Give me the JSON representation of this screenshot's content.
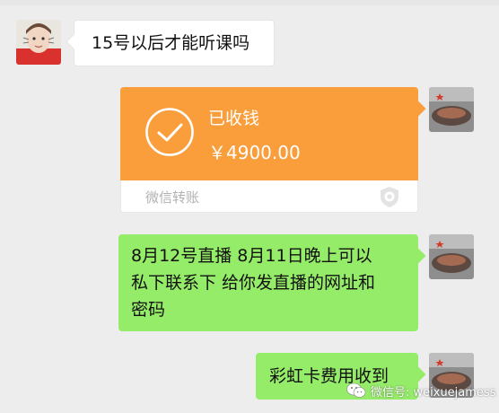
{
  "messages": [
    {
      "side": "left",
      "type": "text",
      "text": "15号以后才能听课吗"
    },
    {
      "side": "right",
      "type": "transfer",
      "status": "已收钱",
      "amount": "￥4900.00",
      "label": "微信转账",
      "icons": {
        "status": "check-circle-icon",
        "footer": "shield-icon"
      }
    },
    {
      "side": "right",
      "type": "text",
      "lines": [
        "8月12号直播 8月11日晚上可以",
        "私下联系下 给你发直播的网址和",
        "密码"
      ]
    },
    {
      "side": "right",
      "type": "text",
      "text": "彩虹卡费用收到"
    }
  ],
  "watermark": {
    "text": "微信号: weixuejamess",
    "icon": "wechat-logo-icon"
  },
  "colors": {
    "background": "#ededed",
    "transfer_orange": "#fa9d3b",
    "bubble_green": "#95ec69",
    "bubble_white": "#ffffff",
    "footer_label": "#b2b2b2"
  }
}
